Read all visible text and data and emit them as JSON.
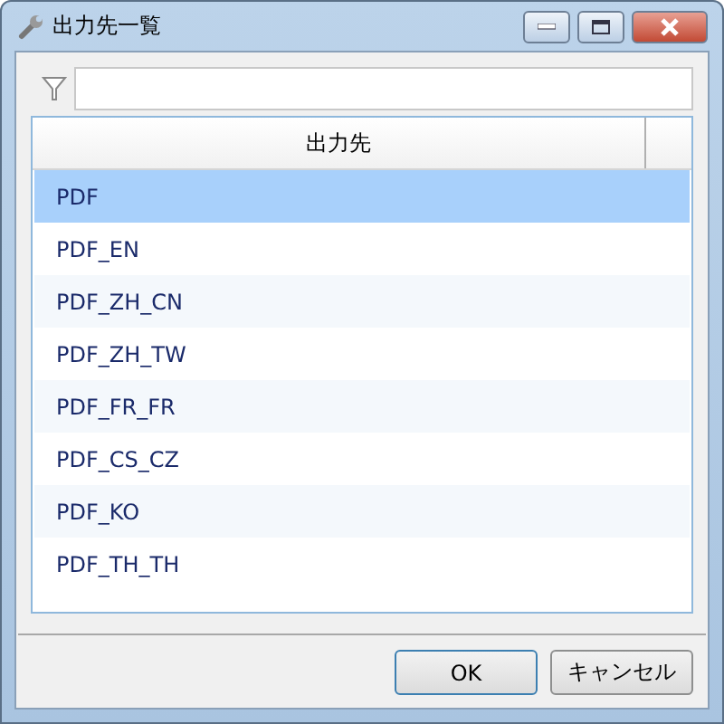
{
  "window": {
    "title": "出力先一覧"
  },
  "table": {
    "columns": [
      "出力先"
    ],
    "rows": [
      {
        "label": "PDF",
        "selected": true
      },
      {
        "label": "PDF_EN",
        "selected": false
      },
      {
        "label": "PDF_ZH_CN",
        "selected": false
      },
      {
        "label": "PDF_ZH_TW",
        "selected": false
      },
      {
        "label": "PDF_FR_FR",
        "selected": false
      },
      {
        "label": "PDF_CS_CZ",
        "selected": false
      },
      {
        "label": "PDF_KO",
        "selected": false
      },
      {
        "label": "PDF_TH_TH",
        "selected": false
      }
    ]
  },
  "buttons": [
    {
      "label": "OK",
      "kind": "default"
    },
    {
      "label": "キャンセル",
      "kind": "normal"
    }
  ]
}
